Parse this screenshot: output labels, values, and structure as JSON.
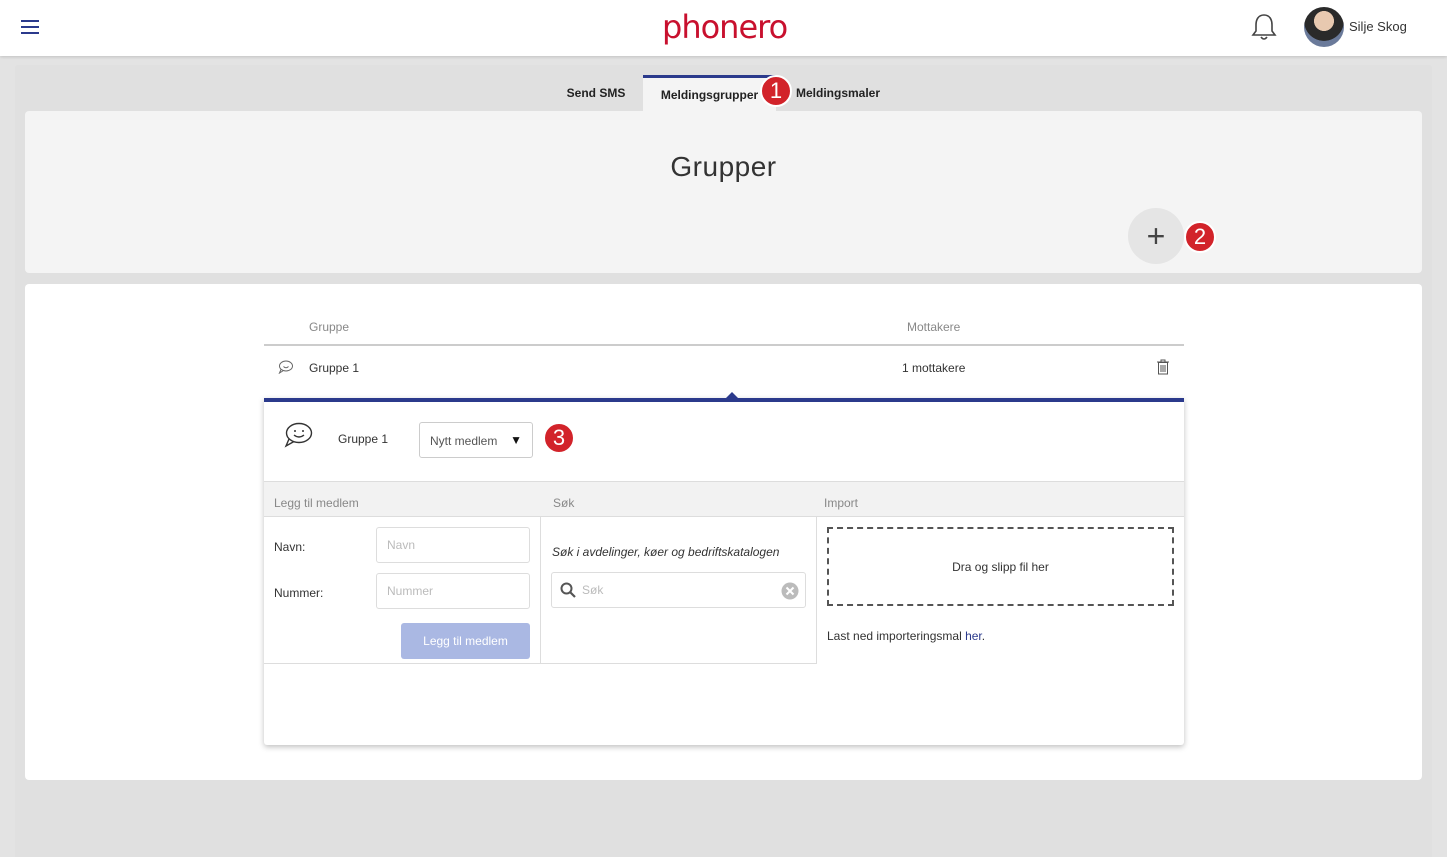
{
  "header": {
    "logo": "phonero",
    "user_name": "Silje Skog"
  },
  "tabs": [
    {
      "label": "Send SMS",
      "active": false
    },
    {
      "label": "Meldingsgrupper",
      "active": true
    },
    {
      "label": "Meldingsmaler",
      "active": false
    }
  ],
  "badges": [
    "1",
    "2",
    "3"
  ],
  "page": {
    "title": "Grupper",
    "add_button": "+"
  },
  "table": {
    "columns": [
      "Gruppe",
      "Mottakere"
    ],
    "rows": [
      {
        "name": "Gruppe 1",
        "recipients": "1 mottakere"
      }
    ]
  },
  "panel": {
    "group_name": "Gruppe 1",
    "dropdown_value": "Nytt medlem",
    "sections": [
      "Legg til medlem",
      "Søk",
      "Import"
    ],
    "add_member": {
      "name_label": "Navn:",
      "name_placeholder": "Navn",
      "number_label": "Nummer:",
      "number_placeholder": "Nummer",
      "button": "Legg til medlem"
    },
    "search": {
      "hint": "Søk i avdelinger, køer og bedriftskatalogen",
      "placeholder": "Søk"
    },
    "import": {
      "dropzone": "Dra og slipp fil her",
      "note_prefix": "Last ned importeringsmal ",
      "note_link": "her",
      "note_suffix": "."
    }
  },
  "colors": {
    "brand_red": "#c8102e",
    "accent_blue": "#2b3a8c",
    "badge_red": "#d2232a",
    "button_disabled": "#aab8e3"
  }
}
